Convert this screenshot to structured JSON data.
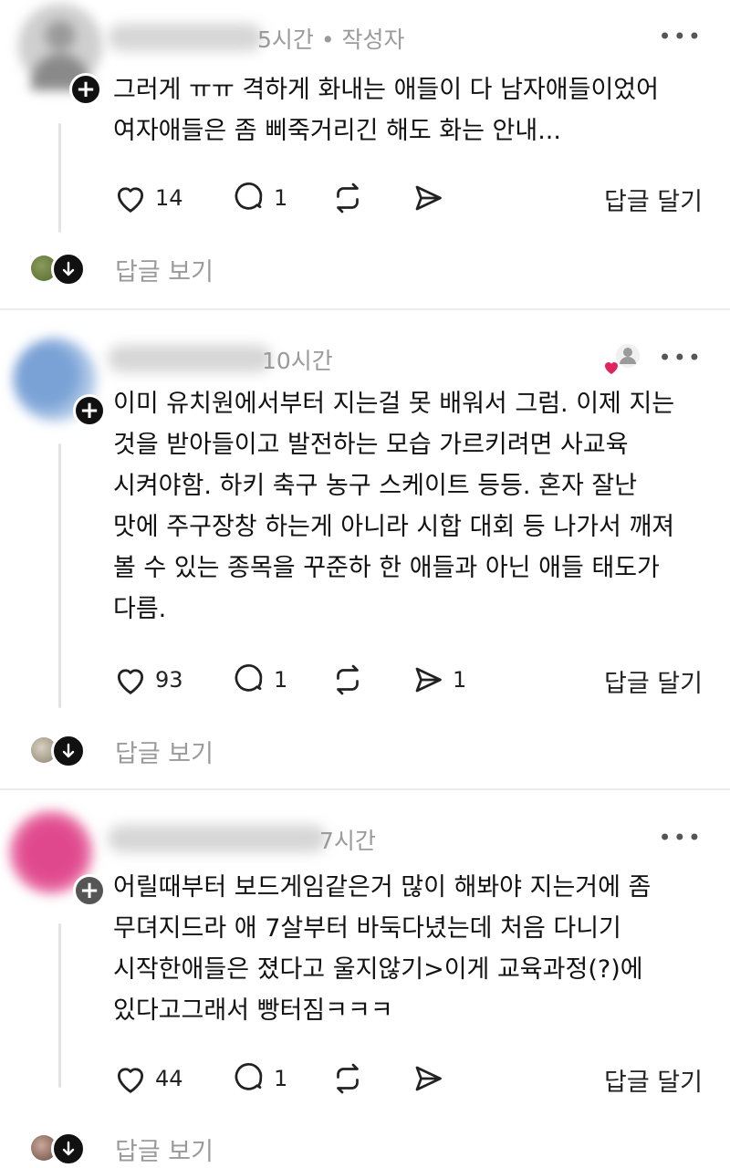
{
  "posts": [
    {
      "time": "5시간 • 작성자",
      "more": "•••",
      "text_lines": [
        "그러게 ㅠㅠ 격하게 화내는 애들이 다 남자애들이었어",
        "여자애들은 좀 삐죽거리긴 해도 화는 안내..."
      ],
      "likes": "14",
      "comments": "1",
      "shares": "",
      "reply_label": "답글 달기",
      "view_replies": "답글 보기"
    },
    {
      "time": "10시간",
      "more": "•••",
      "text_lines": [
        "이미 유치원에서부터 지는걸 못 배워서 그럼. 이제 지는",
        "것을 받아들이고 발전하는 모습 가르키려면 사교육",
        "시켜야함. 하키 축구 농구 스케이트 등등. 혼자 잘난",
        "맛에 주구장창 하는게 아니라 시합 대회 등 나가서 깨져",
        "볼 수 있는 종목을 꾸준하 한 애들과 아닌 애들 태도가",
        "다름."
      ],
      "likes": "93",
      "comments": "1",
      "shares": "1",
      "reply_label": "답글 달기",
      "view_replies": "답글 보기"
    },
    {
      "time": "7시간",
      "more": "•••",
      "text_lines": [
        "어릴때부터 보드게임같은거 많이 해봐야 지는거에 좀",
        "무뎌지드라 애 7살부터 바둑다녔는데 처음 다니기",
        "시작한애들은 졌다고 울지않기>이게 교육과정(?)에",
        "있다고그래서 빵터짐ㅋㅋㅋ"
      ],
      "likes": "44",
      "comments": "1",
      "shares": "",
      "reply_label": "답글 달기",
      "view_replies": "답글 보기"
    }
  ],
  "icons": {
    "like": "heart-icon",
    "comment": "comment-icon",
    "repost": "repost-icon",
    "share": "send-icon",
    "follow": "plus-icon",
    "expand": "arrow-down-icon",
    "liked_by_author": "heart-person-icon"
  },
  "colors": {
    "text": "#111111",
    "muted": "#9a9a9a",
    "heart_red": "#e0245e"
  }
}
